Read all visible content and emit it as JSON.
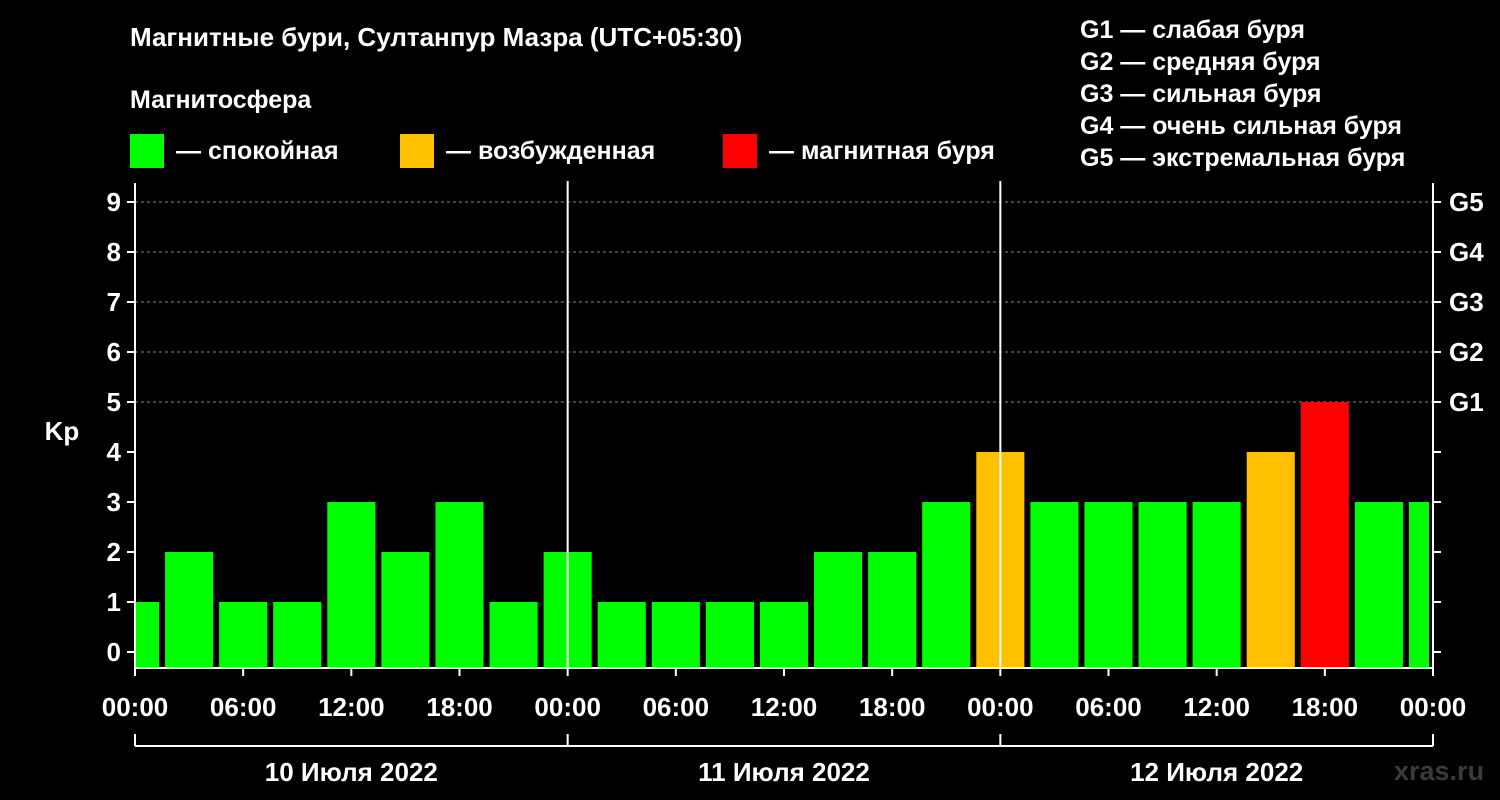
{
  "header": {
    "title": "Магнитные бури, Султанпур Мазра (UTC+05:30)",
    "subtitle": "Магнитосфера"
  },
  "legend": {
    "items": [
      {
        "label": "— спокойная",
        "color": "#00ff00"
      },
      {
        "label": "— возбужденная",
        "color": "#ffc000"
      },
      {
        "label": "— магнитная буря",
        "color": "#ff0000"
      }
    ]
  },
  "storm_levels": [
    "G1 — слабая буря",
    "G2 — средняя буря",
    "G3 — сильная буря",
    "G4 — очень сильная буря",
    "G5 — экстремальная буря"
  ],
  "watermark": "xras.ru",
  "chart_data": {
    "type": "bar",
    "title": "Магнитные бури, Султанпур Мазра (UTC+05:30)",
    "ylabel": "Kp",
    "ylim": [
      0,
      9
    ],
    "y_ticks": [
      "0",
      "1",
      "2",
      "3",
      "4",
      "5",
      "6",
      "7",
      "8",
      "9"
    ],
    "right_ticks": [
      {
        "value": 5,
        "label": "G1"
      },
      {
        "value": 6,
        "label": "G2"
      },
      {
        "value": 7,
        "label": "G3"
      },
      {
        "value": 8,
        "label": "G4"
      },
      {
        "value": 9,
        "label": "G5"
      }
    ],
    "x_tick_labels": [
      "00:00",
      "06:00",
      "12:00",
      "18:00",
      "00:00",
      "06:00",
      "12:00",
      "18:00",
      "00:00",
      "06:00",
      "12:00",
      "18:00",
      "00:00"
    ],
    "days": [
      "10 Июля 2022",
      "11 Июля 2022",
      "12 Июля 2022"
    ],
    "grid": true,
    "values": [
      1,
      2,
      1,
      1,
      3,
      2,
      3,
      1,
      2,
      1,
      1,
      1,
      1,
      2,
      2,
      3,
      4,
      3,
      3,
      3,
      3,
      4,
      5,
      3,
      3
    ],
    "colors": {
      "quiet": "#00ff00",
      "active": "#ffc000",
      "storm": "#ff0000"
    }
  }
}
